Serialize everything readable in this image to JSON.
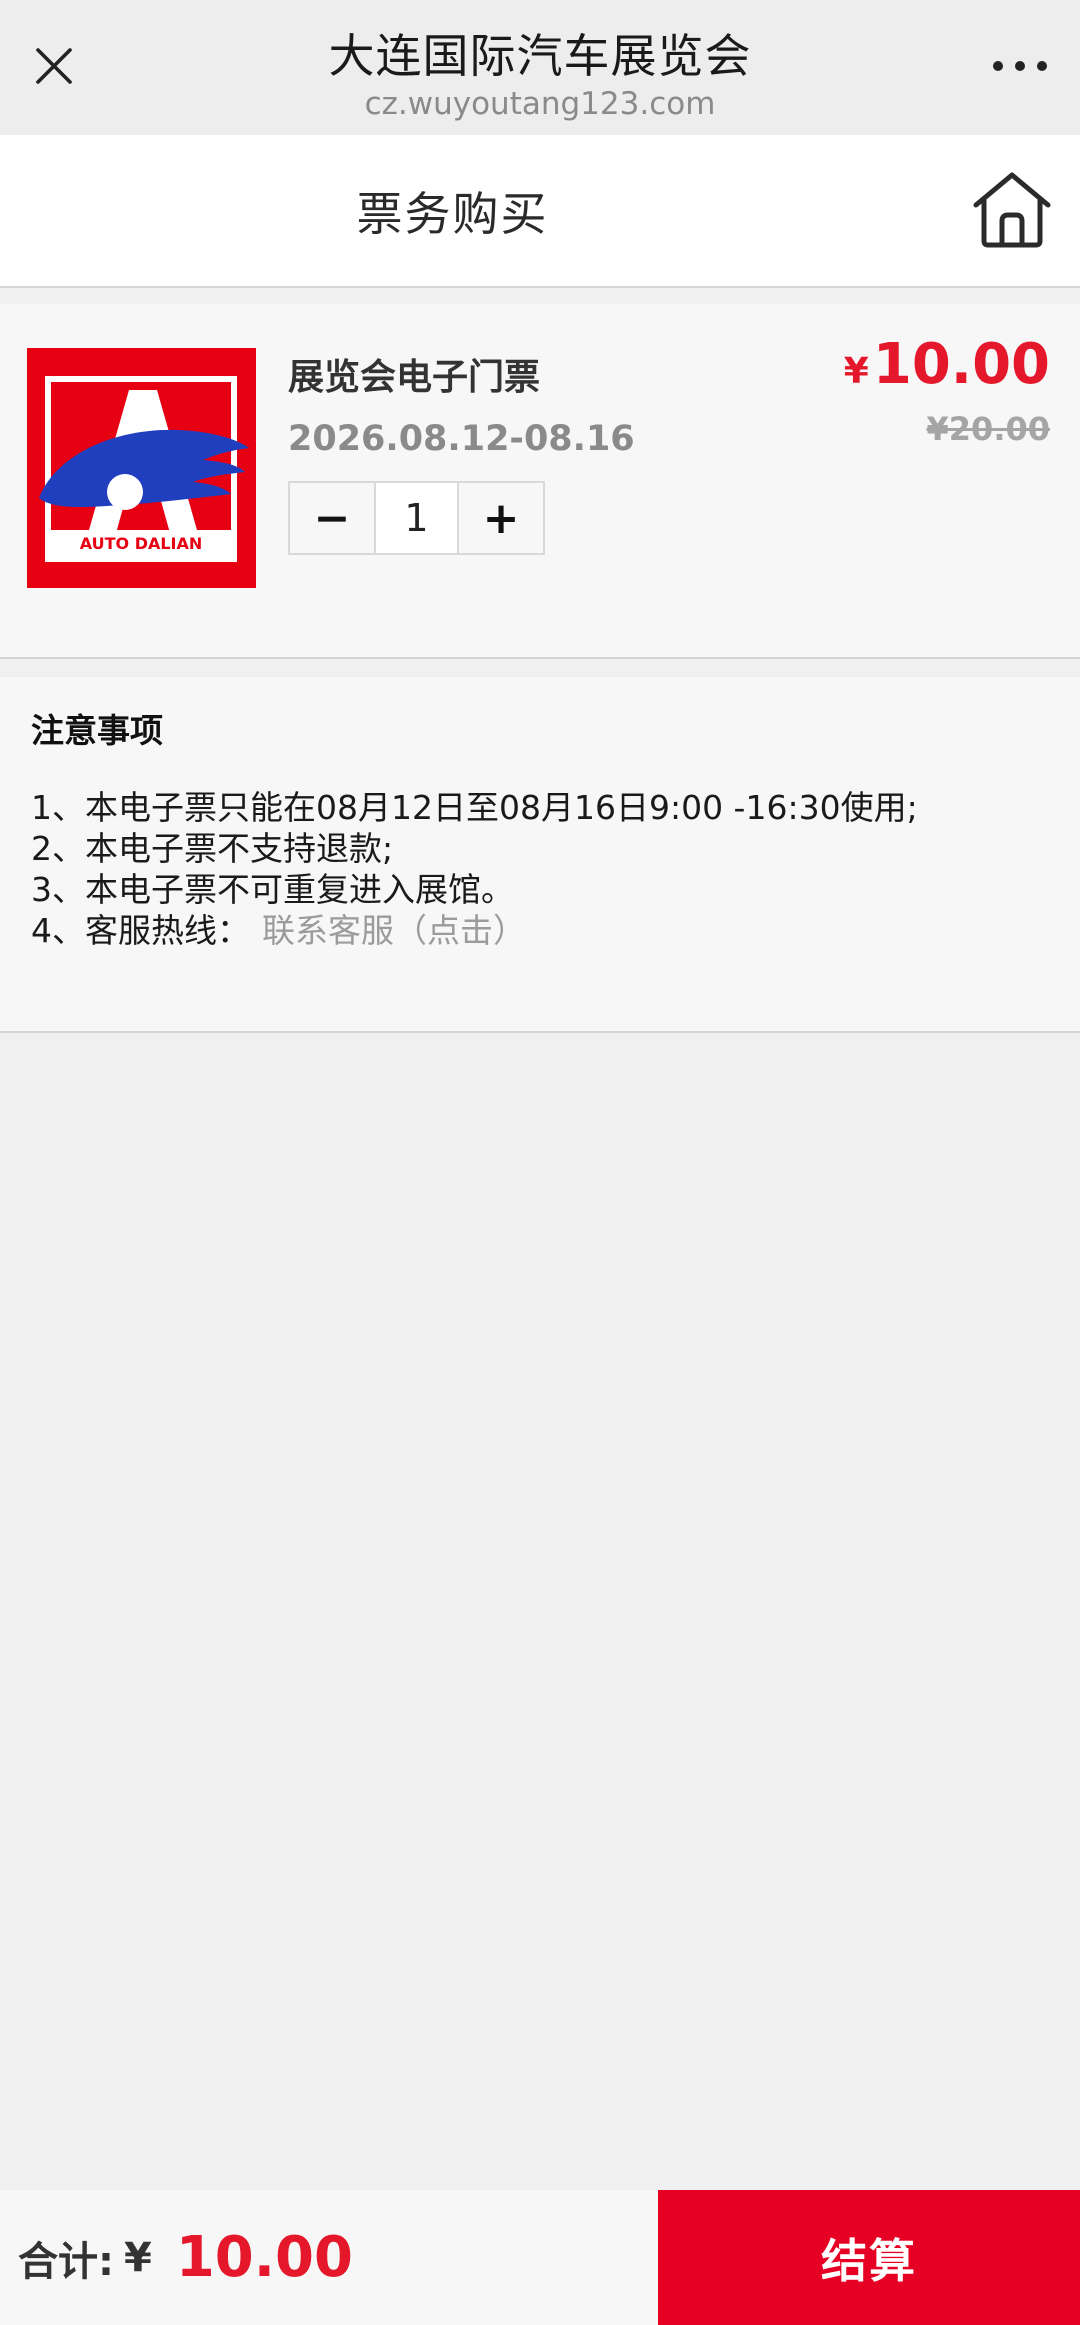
{
  "topbar": {
    "title": "大连国际汽车展览会",
    "url": "cz.wuyoutang123.com",
    "close_icon": "close-icon",
    "more_icon": "more-dots-icon"
  },
  "header": {
    "title": "票务购买",
    "home_icon": "home-icon"
  },
  "product": {
    "name": "展览会电子门票",
    "date": "2026.08.12-08.16",
    "price_symbol": "¥",
    "price": "10.00",
    "original_price": "¥20.00",
    "quantity": "1",
    "minus_label": "−",
    "plus_label": "+",
    "logo_text": "AUTO DALIAN",
    "logo_letter": "A"
  },
  "notes": {
    "heading": "注意事项",
    "items": [
      "1、本电子票只能在08月12日至08月16日9:00 -16:30使用;",
      "2、本电子票不支持退款;",
      "3、本电子票不可重复进入展馆。",
      "4、客服热线："
    ],
    "contact_link": "联系客服（点击）"
  },
  "footer": {
    "total_label": "合计:",
    "currency": "¥",
    "total_value": "10.00",
    "checkout_label": "结算"
  },
  "colors": {
    "accent_red": "#e4172b",
    "checkout_red": "#e60023",
    "logo_blue": "#1f3fbf"
  }
}
